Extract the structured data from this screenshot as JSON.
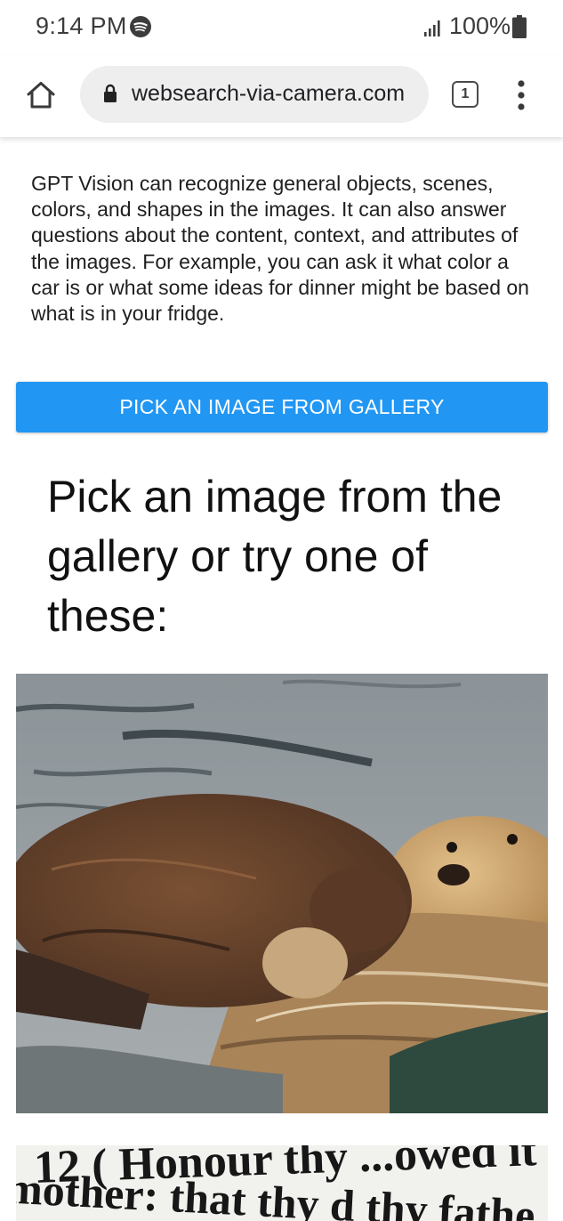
{
  "status_bar": {
    "time": "9:14 PM",
    "battery": "100%",
    "icons": [
      "spotify-icon",
      "signal-icon",
      "battery-icon"
    ]
  },
  "browser": {
    "url": "websearch-via-camera.com",
    "tab_count": "1",
    "icons": [
      "home-icon",
      "lock-icon",
      "tab-switcher-icon",
      "more-vert-icon"
    ]
  },
  "content": {
    "intro": "GPT Vision can recognize general objects, scenes, colors, and shapes in the images. It can also answer questions about the content, context, and attributes of the images. For example, you can ask it what color a car is or what some ideas for dinner might be based on what is in your fridge.",
    "pick_button_label": "PICK AN IMAGE FROM GALLERY",
    "heading": "Pick an image from the gallery or try one of these:",
    "sample_text_image": {
      "line1": "12  ( Honour thy  ...owed it",
      "line2": "mother: that thy d   thy fathe"
    }
  },
  "colors": {
    "accent": "#2196f3",
    "url_bar_bg": "#eeeeee",
    "text": "#1f1f1f"
  }
}
